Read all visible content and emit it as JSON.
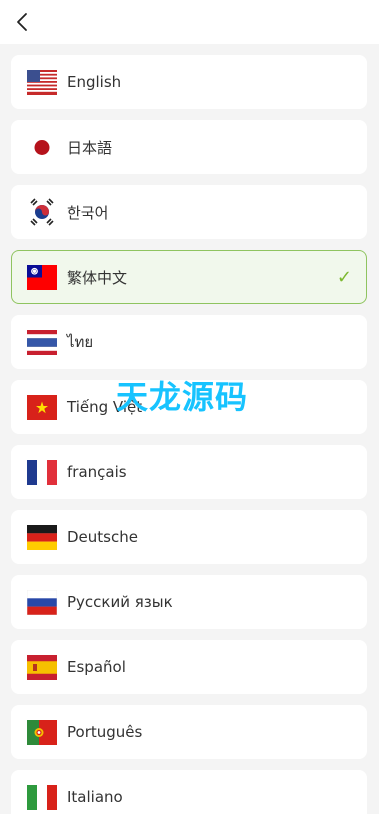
{
  "header": {
    "back_icon": "chevron-left-icon"
  },
  "colors": {
    "selected_border": "#8fc460",
    "selected_bg": "#f1f8ec",
    "check": "#7cb82f",
    "watermark": "#17c3ff"
  },
  "languages": [
    {
      "label": "English",
      "flag": "us-flag-icon"
    },
    {
      "label": "日本語",
      "flag": "japan-flag-icon"
    },
    {
      "label": "한국어",
      "flag": "korea-flag-icon"
    },
    {
      "label": "繁体中文",
      "flag": "taiwan-flag-icon",
      "selected": true,
      "check": "✓"
    },
    {
      "label": "ไทย",
      "flag": "thailand-flag-icon"
    },
    {
      "label": "Tiếng Việt",
      "flag": "vietnam-flag-icon"
    },
    {
      "label": "français",
      "flag": "france-flag-icon"
    },
    {
      "label": "Deutsche",
      "flag": "germany-flag-icon"
    },
    {
      "label": "Русский язык",
      "flag": "russia-flag-icon"
    },
    {
      "label": "Español",
      "flag": "spain-flag-icon"
    },
    {
      "label": "Português",
      "flag": "portugal-flag-icon"
    },
    {
      "label": "Italiano",
      "flag": "italy-flag-icon"
    }
  ],
  "watermark": "天龙源码"
}
